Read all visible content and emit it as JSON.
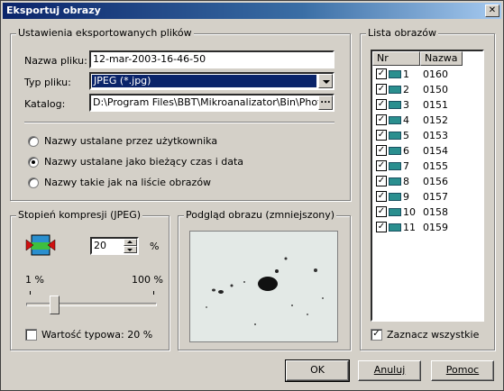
{
  "window": {
    "title": "Eksportuj obrazy",
    "close_glyph": "✕"
  },
  "settings": {
    "group_title": "Ustawienia eksportowanych plików",
    "filename_label": "Nazwa pliku:",
    "filename_value": "12-mar-2003-16-46-50",
    "filetype_label": "Typ pliku:",
    "filetype_value": "JPEG (*.jpg)",
    "folder_label": "Katalog:",
    "folder_value": "D:\\Program Files\\BBT\\Mikroanalizator\\Bin\\Photos",
    "folder_button": "...",
    "radio_options": [
      {
        "label": "Nazwy ustalane przez użytkownika",
        "selected": false
      },
      {
        "label": "Nazwy ustalane jako bieżący czas i data",
        "selected": true
      },
      {
        "label": "Nazwy takie jak na liście obrazów",
        "selected": false
      }
    ]
  },
  "compression": {
    "group_title": "Stopień kompresji (JPEG)",
    "value": "20",
    "unit": "%",
    "min_label": "1 %",
    "max_label": "100 %",
    "slider_value": 20,
    "typical_label": "Wartość typowa: 20 %",
    "typical_checked": false
  },
  "preview": {
    "group_title": "Podgląd obrazu (zmniejszony)"
  },
  "image_list": {
    "group_title": "Lista obrazów",
    "columns": [
      "Nr",
      "Nazwa"
    ],
    "rows": [
      {
        "nr": "1",
        "name": "0160",
        "checked": true
      },
      {
        "nr": "2",
        "name": "0150",
        "checked": true
      },
      {
        "nr": "3",
        "name": "0151",
        "checked": true
      },
      {
        "nr": "4",
        "name": "0152",
        "checked": true
      },
      {
        "nr": "5",
        "name": "0153",
        "checked": true
      },
      {
        "nr": "6",
        "name": "0154",
        "checked": true
      },
      {
        "nr": "7",
        "name": "0155",
        "checked": true
      },
      {
        "nr": "8",
        "name": "0156",
        "checked": true
      },
      {
        "nr": "9",
        "name": "0157",
        "checked": true
      },
      {
        "nr": "10",
        "name": "0158",
        "checked": true
      },
      {
        "nr": "11",
        "name": "0159",
        "checked": true
      }
    ],
    "select_all_label": "Zaznacz wszystkie",
    "select_all_checked": true
  },
  "buttons": {
    "ok": "OK",
    "cancel": "Anuluj",
    "help": "Pomoc"
  },
  "check_glyph": "✓"
}
